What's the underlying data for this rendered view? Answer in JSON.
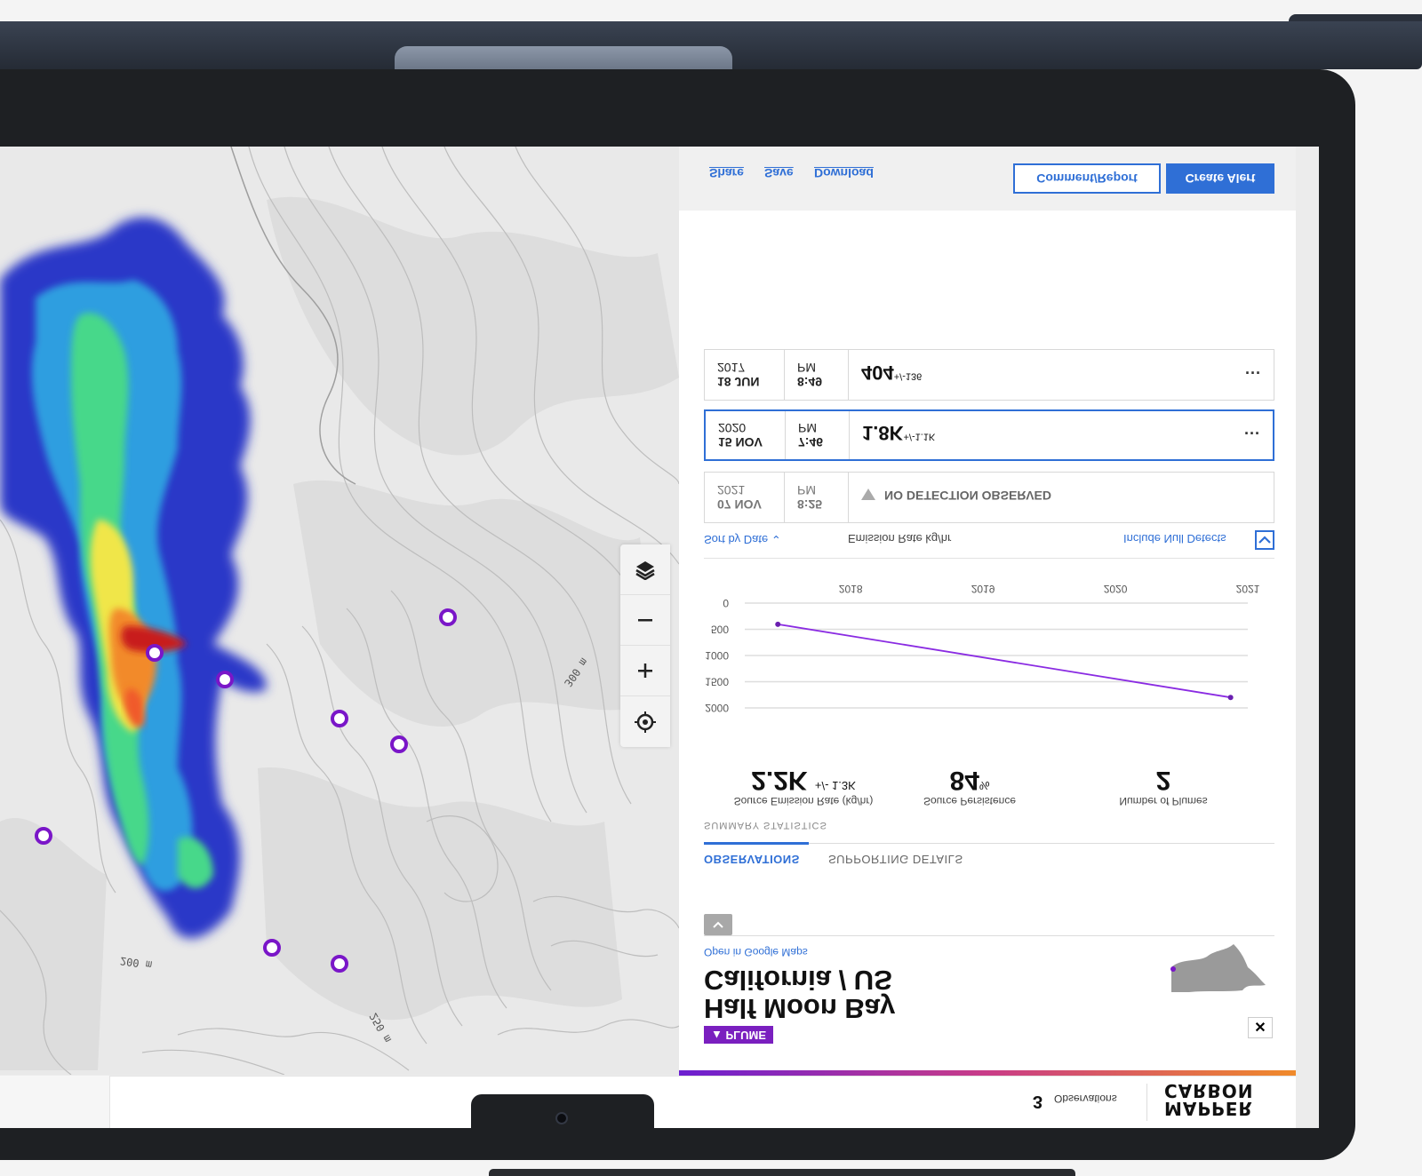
{
  "header": {
    "share": "Share",
    "save": "Save",
    "download": "Download",
    "comment_report": "Comment/Report",
    "create_alert": "Create Alert"
  },
  "observations": [
    {
      "date_line1": "18 JUN",
      "date_line2": "2017",
      "time_line1": "8:49",
      "time_line2": "PM",
      "value": "404",
      "uncertainty": "+/-136"
    },
    {
      "date_line1": "15 NOV",
      "date_line2": "2020",
      "time_line1": "7:46",
      "time_line2": "PM",
      "value": "1.8K",
      "uncertainty": "+/-1.1K"
    },
    {
      "date_line1": "07 NOV",
      "date_line2": "2021",
      "time_line1": "8:25",
      "time_line2": "PM",
      "null_label": "NO DETECTION OBSERVED"
    }
  ],
  "more_glyph": "···",
  "controls": {
    "sort_by": "Sort by Date",
    "emission_rate_label": "Emission Rate kg/hr",
    "include_null": "Include Null Detects"
  },
  "chart_data": {
    "type": "line",
    "x": [
      2017.45,
      2020.87
    ],
    "values": [
      404,
      1800
    ],
    "x_ticks": [
      "2018",
      "2019",
      "2020",
      "2021"
    ],
    "y_ticks": [
      "0",
      "500",
      "1000",
      "1500",
      "2000"
    ],
    "xlim": [
      2017.2,
      2021.0
    ],
    "ylim": [
      0,
      2000
    ],
    "y_inverted": true,
    "grid": true,
    "line_color": "#8a2be2"
  },
  "stats": {
    "emission": {
      "label": "Source Emission Rate (kg/hr)",
      "value": "2.2K",
      "uncertainty": "+/- 1.3K"
    },
    "persistence": {
      "label": "Source Persistence",
      "value": "84",
      "unit": "%"
    },
    "plumes": {
      "label": "Number of Plumes",
      "value": "2"
    },
    "summary_label": "SUMMARY STATISTICS"
  },
  "tabs": {
    "observations": "OBSERVATIONS",
    "supporting": "SUPPORTING DETAILS"
  },
  "location": {
    "google_maps_link": "Open in Google Maps",
    "line1": "California / US",
    "line2": "Half Moon Bay",
    "badge": "PLUME"
  },
  "map": {
    "contour_labels": [
      "300 m",
      "200 m",
      "250 m"
    ]
  },
  "footer": {
    "observation_count": "3",
    "observation_label": "Observations",
    "logo_line1": "CARBON",
    "logo_line2": "MAPPER"
  },
  "colors": {
    "accent_blue": "#2f6fd6",
    "plume_purple": "#7a1fbf",
    "source_marker": "#7a16c8"
  },
  "icons": {
    "layers": "layers-icon",
    "zoom_out": "minus-icon",
    "zoom_in": "plus-icon",
    "locate": "crosshair-icon",
    "close": "close-icon",
    "collapse": "chevron-up-icon",
    "sort": "chevron-down-icon",
    "checkbox": "checkmark-icon",
    "null_detect": "triangle-icon"
  }
}
